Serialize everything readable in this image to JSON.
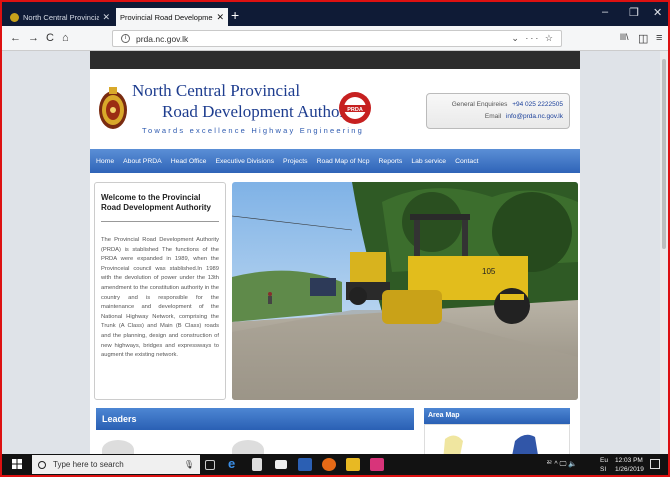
{
  "browser": {
    "tabs": [
      {
        "label": "North Central Provincial Counc"
      },
      {
        "label": "Provincial Road Development Auth"
      }
    ],
    "new_tab_symbol": "+",
    "close_symbol": "✕",
    "url": "prda.nc.gov.lk",
    "url_right_icons": "⌄ ··· ☆",
    "window_controls": {
      "minimize": "–",
      "restore": "❐",
      "close": "✕"
    }
  },
  "site": {
    "title_line1": "North Central Provincial",
    "title_line2": "Road Development Authority",
    "tagline": "Towards excellence Highway Engineering",
    "badge_text": "PRDA",
    "enquiries_label": "General Enquireies",
    "enquiries_phone": "+94 025 2222505",
    "email_label": "Email",
    "email_value": "info@prda.nc.gov.lk",
    "nav": [
      "Home",
      "About PRDA",
      "Head Office",
      "Executive Divisions",
      "Projects",
      "Road Map of Ncp",
      "Reports",
      "Lab service",
      "Contact"
    ],
    "welcome_title": "Welcome to the Provincial Road Development Authority",
    "welcome_body": "The Provincial Road Development Authority (PRDA) is stablished The functions of the PRDA were expanded in 1989, when the Provinceial council was stablished.In 1989 with the devolution of power under the 13th amendment to the constitution authority in the country and is responsible for the maintenance and development of the National Highway Network, comprising the Trunk (A Class) and Main (B Class) roads and the planning, design and construction of new highways, bridges and expressways to augment the existing network.",
    "leaders_heading": "Leaders",
    "area_map_heading": "Area Map",
    "roller_number": "105"
  },
  "taskbar": {
    "search_placeholder": "Type here to search",
    "tray_text": "ᄙ ^ 🖵 🔈",
    "lang_top": "Eu",
    "lang_bottom": "SI",
    "time": "12:03 PM",
    "date": "1/26/2019"
  },
  "colors": {
    "tabbar": "#0f1b36",
    "nav": "#2f64b8",
    "title": "#1e3d8f",
    "frame": "#dd1111"
  }
}
